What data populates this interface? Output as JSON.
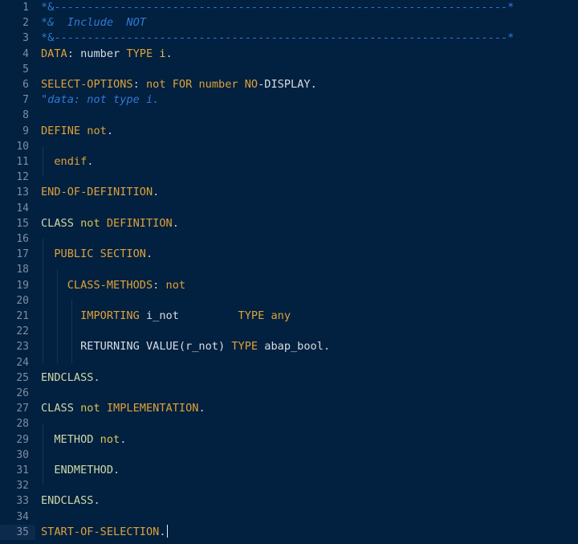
{
  "editor": {
    "language": "ABAP",
    "colors": {
      "background": "#02203f",
      "keyword": "#dca23a",
      "comment": "#2f7ad6",
      "identifier": "#d8dde3",
      "line_number": "#7d8ea3"
    },
    "current_line": 35,
    "lines": [
      {
        "n": "1",
        "tokens": [
          {
            "t": "*&---------------------------------------------------------------------*",
            "c": "cmt-plain"
          }
        ]
      },
      {
        "n": "2",
        "tokens": [
          {
            "t": "*&  Include  NOT",
            "c": "cmt"
          }
        ]
      },
      {
        "n": "3",
        "tokens": [
          {
            "t": "*&---------------------------------------------------------------------*",
            "c": "cmt-plain"
          }
        ]
      },
      {
        "n": "4",
        "tokens": [
          {
            "t": "DATA",
            "c": "kw"
          },
          {
            "t": ": ",
            "c": "punc"
          },
          {
            "t": "number ",
            "c": "id"
          },
          {
            "t": "TYPE ",
            "c": "kw"
          },
          {
            "t": "i",
            "c": "name"
          },
          {
            "t": ".",
            "c": "punc"
          }
        ]
      },
      {
        "n": "5",
        "tokens": []
      },
      {
        "n": "6",
        "tokens": [
          {
            "t": "SELECT-OPTIONS",
            "c": "kw"
          },
          {
            "t": ": ",
            "c": "punc"
          },
          {
            "t": "not ",
            "c": "kw"
          },
          {
            "t": "FOR ",
            "c": "kw"
          },
          {
            "t": "number ",
            "c": "kw"
          },
          {
            "t": "NO",
            "c": "kw"
          },
          {
            "t": "-DISPLAY.",
            "c": "id"
          }
        ]
      },
      {
        "n": "7",
        "tokens": [
          {
            "t": "\"data: not type i.",
            "c": "cmt"
          }
        ]
      },
      {
        "n": "8",
        "tokens": []
      },
      {
        "n": "9",
        "tokens": [
          {
            "t": "DEFINE ",
            "c": "kw"
          },
          {
            "t": "not",
            "c": "kw"
          },
          {
            "t": ".",
            "c": "punc"
          }
        ]
      },
      {
        "n": "10",
        "tokens": []
      },
      {
        "n": "11",
        "tokens": [
          {
            "t": "  endif",
            "c": "kw"
          },
          {
            "t": ".",
            "c": "punc"
          }
        ]
      },
      {
        "n": "12",
        "tokens": []
      },
      {
        "n": "13",
        "tokens": [
          {
            "t": "END-OF-DEFINITION",
            "c": "kw"
          },
          {
            "t": ".",
            "c": "punc"
          }
        ]
      },
      {
        "n": "14",
        "tokens": []
      },
      {
        "n": "15",
        "tokens": [
          {
            "t": "CLASS ",
            "c": "kw2"
          },
          {
            "t": "not ",
            "c": "name"
          },
          {
            "t": "DEFINITION",
            "c": "kw"
          },
          {
            "t": ".",
            "c": "punc"
          }
        ]
      },
      {
        "n": "16",
        "tokens": []
      },
      {
        "n": "17",
        "tokens": [
          {
            "t": "  PUBLIC SECTION",
            "c": "kw"
          },
          {
            "t": ".",
            "c": "punc"
          }
        ]
      },
      {
        "n": "18",
        "tokens": []
      },
      {
        "n": "19",
        "tokens": [
          {
            "t": "    CLASS-METHODS",
            "c": "kw"
          },
          {
            "t": ": ",
            "c": "punc"
          },
          {
            "t": "not",
            "c": "kw"
          }
        ]
      },
      {
        "n": "20",
        "tokens": []
      },
      {
        "n": "21",
        "tokens": [
          {
            "t": "      IMPORTING ",
            "c": "kw"
          },
          {
            "t": "i_not         ",
            "c": "id"
          },
          {
            "t": "TYPE ",
            "c": "kw"
          },
          {
            "t": "any",
            "c": "kw"
          }
        ]
      },
      {
        "n": "22",
        "tokens": []
      },
      {
        "n": "23",
        "tokens": [
          {
            "t": "      RETURNING VALUE(r_not) ",
            "c": "id"
          },
          {
            "t": "TYPE ",
            "c": "kw"
          },
          {
            "t": "abap_bool",
            "c": "id"
          },
          {
            "t": ".",
            "c": "punc"
          }
        ]
      },
      {
        "n": "24",
        "tokens": []
      },
      {
        "n": "25",
        "tokens": [
          {
            "t": "ENDCLASS",
            "c": "kw2"
          },
          {
            "t": ".",
            "c": "punc"
          }
        ]
      },
      {
        "n": "26",
        "tokens": []
      },
      {
        "n": "27",
        "tokens": [
          {
            "t": "CLASS ",
            "c": "kw2"
          },
          {
            "t": "not ",
            "c": "name"
          },
          {
            "t": "IMPLEMENTATION",
            "c": "kw"
          },
          {
            "t": ".",
            "c": "punc"
          }
        ]
      },
      {
        "n": "28",
        "tokens": []
      },
      {
        "n": "29",
        "tokens": [
          {
            "t": "  METHOD ",
            "c": "kw2"
          },
          {
            "t": "not",
            "c": "name"
          },
          {
            "t": ".",
            "c": "punc"
          }
        ]
      },
      {
        "n": "30",
        "tokens": []
      },
      {
        "n": "31",
        "tokens": [
          {
            "t": "  ENDMETHOD",
            "c": "kw2"
          },
          {
            "t": ".",
            "c": "punc"
          }
        ]
      },
      {
        "n": "32",
        "tokens": []
      },
      {
        "n": "33",
        "tokens": [
          {
            "t": "ENDCLASS",
            "c": "kw2"
          },
          {
            "t": ".",
            "c": "punc"
          }
        ]
      },
      {
        "n": "34",
        "tokens": []
      },
      {
        "n": "35",
        "tokens": [
          {
            "t": "START-OF-SELECTION",
            "c": "kw"
          },
          {
            "t": ".",
            "c": "punc"
          }
        ]
      }
    ]
  }
}
